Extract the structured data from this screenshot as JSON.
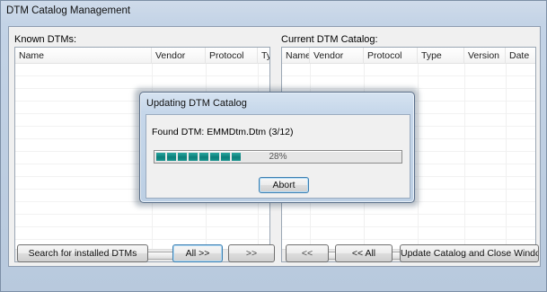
{
  "window": {
    "title": "DTM Catalog Management"
  },
  "known_dtms": {
    "label": "Known DTMs:",
    "columns": [
      "Name",
      "Vendor",
      "Protocol",
      "Type"
    ]
  },
  "current_catalog": {
    "label": "Current DTM Catalog:",
    "columns": [
      "Name",
      "Vendor",
      "Protocol",
      "Type",
      "Version",
      "Date"
    ]
  },
  "scroll": {
    "thumb_grip": "III",
    "left_arrow": "◂",
    "right_arrow": "▸"
  },
  "buttons": {
    "search": "Search for installed DTMs",
    "all_right": "All  >>",
    "right": ">>",
    "left": "<<",
    "all_left": "<< All",
    "update_close": "Update Catalog and Close Window"
  },
  "dialog": {
    "title": "Updating DTM Catalog",
    "found_text": "Found DTM: EMMDtm.Dtm (3/12)",
    "progress_percent": 28,
    "progress_label": "28%",
    "progress_segments": 8,
    "abort_label": "Abort"
  },
  "colors": {
    "progress_fill": "#0c7f7a",
    "focus_border": "#3c7fb1"
  }
}
